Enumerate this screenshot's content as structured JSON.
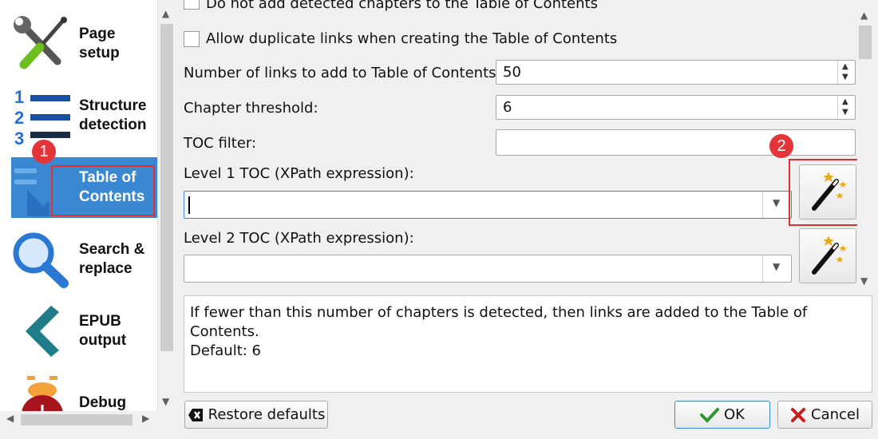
{
  "sidebar": {
    "items": [
      {
        "label": "Page setup",
        "icon": "wrench-screwdriver-icon"
      },
      {
        "label": "Structure detection",
        "icon": "numbered-list-icon"
      },
      {
        "label": "Table of Contents",
        "icon": "toc-icon"
      },
      {
        "label": "Search & replace",
        "icon": "magnifier-icon"
      },
      {
        "label": "EPUB output",
        "icon": "chevron-left-icon"
      },
      {
        "label": "Debug",
        "icon": "bug-icon"
      }
    ],
    "badge1": "1"
  },
  "form": {
    "no_detected_label": "Do not add detected chapters to the Table of Contents",
    "allow_dup_label": "Allow duplicate links when creating the Table of Contents",
    "num_links_label": "Number of links to add to Table of Contents:",
    "num_links_value": "50",
    "chapter_threshold_label": "Chapter threshold:",
    "chapter_threshold_value": "6",
    "toc_filter_label": "TOC filter:",
    "toc_filter_value": "",
    "level1_label": "Level 1 TOC (XPath expression):",
    "level1_value": "",
    "level2_label": "Level 2 TOC (XPath expression):",
    "level2_value": "",
    "badge2": "2"
  },
  "help": {
    "line1": "If fewer than this number of chapters is detected, then links are added to the Table of Contents.",
    "line2": "Default: 6"
  },
  "buttons": {
    "restore": "Restore defaults",
    "ok": "OK",
    "cancel": "Cancel"
  },
  "colors": {
    "accent": "#3a88d1",
    "highlight": "#e0302f",
    "badge": "#e3343a"
  }
}
